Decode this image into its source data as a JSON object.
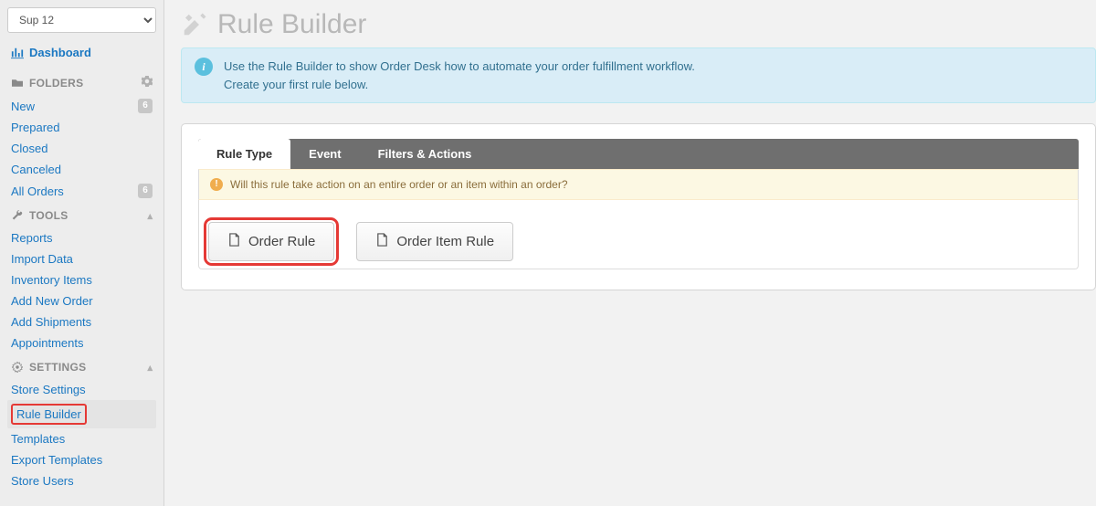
{
  "sidebar": {
    "store_selected": "Sup 12",
    "dashboard_label": "Dashboard",
    "sections": {
      "folders": {
        "title": "FOLDERS",
        "items": [
          {
            "label": "New",
            "badge": "6"
          },
          {
            "label": "Prepared",
            "badge": ""
          },
          {
            "label": "Closed",
            "badge": ""
          },
          {
            "label": "Canceled",
            "badge": ""
          },
          {
            "label": "All Orders",
            "badge": "6"
          }
        ]
      },
      "tools": {
        "title": "TOOLS",
        "items": [
          {
            "label": "Reports"
          },
          {
            "label": "Import Data"
          },
          {
            "label": "Inventory Items"
          },
          {
            "label": "Add New Order"
          },
          {
            "label": "Add Shipments"
          },
          {
            "label": "Appointments"
          }
        ]
      },
      "settings": {
        "title": "SETTINGS",
        "items": [
          {
            "label": "Store Settings"
          },
          {
            "label": "Rule Builder"
          },
          {
            "label": "Templates"
          },
          {
            "label": "Export Templates"
          },
          {
            "label": "Store Users"
          }
        ]
      }
    }
  },
  "page": {
    "title": "Rule Builder",
    "info_line1": "Use the Rule Builder to show Order Desk how to automate your order fulfillment workflow.",
    "info_line2": "Create your first rule below."
  },
  "tabs": {
    "rule_type": "Rule Type",
    "event": "Event",
    "filters_actions": "Filters & Actions"
  },
  "question": "Will this rule take action on an entire order or an item within an order?",
  "buttons": {
    "order_rule": "Order Rule",
    "order_item_rule": "Order Item Rule"
  }
}
